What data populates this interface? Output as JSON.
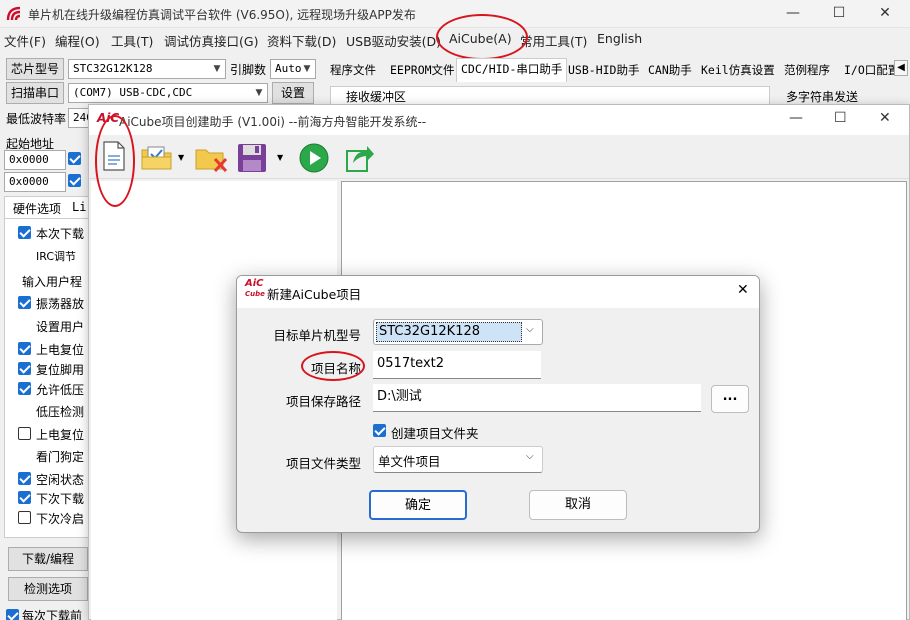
{
  "app": {
    "title": "单片机在线升级编程仿真调试平台软件 (V6.95O), 远程现场升级APP发布",
    "minimize": "—",
    "maximize": "☐",
    "close": "✕"
  },
  "menu": [
    "文件(F)",
    "编程(O)",
    "工具(T)",
    "调试仿真接口(G)",
    "资料下载(D)",
    "USB驱动安装(D)",
    "AiCube(A)",
    "常用工具(T)",
    "English"
  ],
  "left": {
    "chip_label": "芯片型号",
    "chip_value": "STC32G12K128",
    "pin_label": "引脚数",
    "pin_value": "Auto",
    "scan_label": "扫描串口",
    "port_value": "(COM7) USB-CDC,CDC",
    "settings_label": "设置",
    "baud_label": "最低波特率",
    "baud_value": "240",
    "start_addr_label": "起始地址",
    "addr1": "0x0000",
    "addr2": "0x0000",
    "hw_tab": "硬件选项",
    "hw_tab2": "Li",
    "options": [
      "本次下载",
      "IRC调节",
      "输入用户程",
      "振荡器放",
      "设置用户",
      "上电复位",
      "复位脚用",
      "允许低压",
      "低压检测",
      "上电复位",
      "看门狗定",
      "空闲状态",
      "下次下载",
      "下次冷启"
    ],
    "download_btn": "下载/编程",
    "detect_btn": "检测选项",
    "bottom_opt": "每次下载前"
  },
  "tabs": [
    "程序文件",
    "EEPROM文件",
    "CDC/HID-串口助手",
    "USB-HID助手",
    "CAN助手",
    "Keil仿真设置",
    "范例程序",
    "I/O口配置"
  ],
  "right_panel": {
    "recv_label": "接收缓冲区",
    "multi_label": "多字符串发送"
  },
  "sub_window": {
    "logo": "AiC",
    "title": "AiCube项目创建助手 (V1.00i) --前海方舟智能开发系统--",
    "toolbar_icons": [
      "new-file-icon",
      "open-folder-icon",
      "delete-folder-icon",
      "save-icon",
      "run-icon",
      "export-icon"
    ]
  },
  "dialog": {
    "logo_top": "AiC",
    "logo_bottom": "Cube",
    "title": "新建AiCube项目",
    "mcu_label": "目标单片机型号",
    "mcu_value": "STC32G12K128",
    "name_label": "项目名称",
    "name_value": "0517text2",
    "path_label": "项目保存路径",
    "path_value": "D:\\测试",
    "browse": "...",
    "create_folder": "创建项目文件夹",
    "type_label": "项目文件类型",
    "type_value": "单文件项目",
    "ok": "确定",
    "cancel": "取消"
  },
  "colors": {
    "annotation": "#d8141e",
    "accent": "#2a6bd1"
  }
}
